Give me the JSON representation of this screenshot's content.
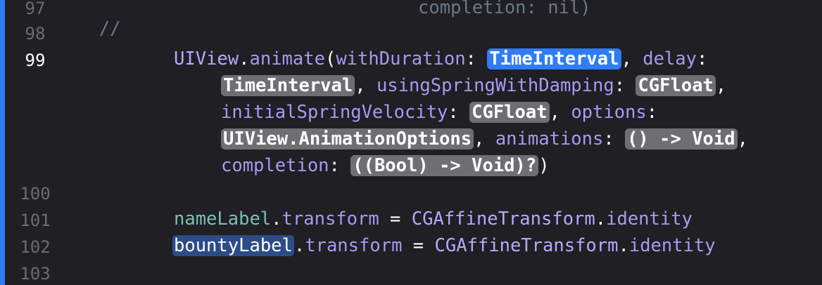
{
  "editor": {
    "lines": {
      "n97": "97",
      "n98": "98",
      "n99": "99",
      "n100": "100",
      "n101": "101",
      "n102": "102",
      "n103": "103"
    },
    "line97": {
      "comment": "//",
      "text": "completion: nil)"
    },
    "line99": {
      "l1_obj": "UIView",
      "l1_dot": ".",
      "l1_fn": "animate",
      "l1_paren": "(",
      "l1_p1": "withDuration",
      "l1_colon1": ": ",
      "l1_ph1": "TimeInterval",
      "l1_comma1": ", ",
      "l1_p2": "delay",
      "l1_colon2": ":",
      "l2_ph2": "TimeInterval",
      "l2_comma2": ", ",
      "l2_p3": "usingSpringWithDamping",
      "l2_colon3": ": ",
      "l2_ph3": "CGFloat",
      "l2_comma3": ",",
      "l3_p4": "initialSpringVelocity",
      "l3_colon4": ": ",
      "l3_ph4": "CGFloat",
      "l3_comma4": ", ",
      "l3_p5": "options",
      "l3_colon5": ":",
      "l4_ph5": "UIView.AnimationOptions",
      "l4_comma5": ", ",
      "l4_p6": "animations",
      "l4_colon6": ": ",
      "l4_ph6": "() -> Void",
      "l4_comma6": ",",
      "l5_p7": "completion",
      "l5_colon7": ": ",
      "l5_ph7": "((Bool) -> Void)?",
      "l5_close": ")"
    },
    "line101": {
      "var": "nameLabel",
      "dot": ".",
      "prop": "transform",
      "eq": " = ",
      "cls": "CGAffineTransform",
      "dot2": ".",
      "prop2": "identity"
    },
    "line102": {
      "var": "bountyLabel",
      "dot": ".",
      "prop": "transform",
      "eq": " = ",
      "cls": "CGAffineTransform",
      "dot2": ".",
      "prop2": "identity"
    }
  }
}
